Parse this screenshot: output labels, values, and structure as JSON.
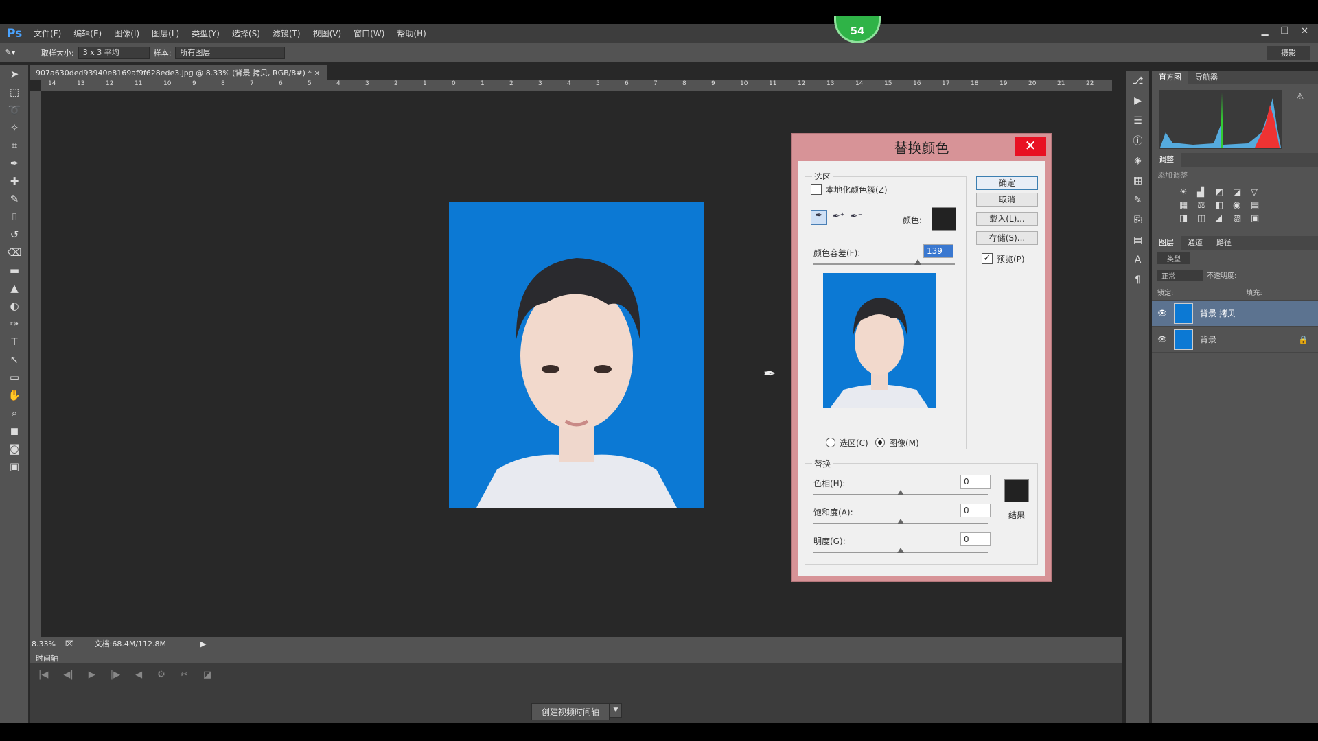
{
  "menubar": {
    "logo": "Ps",
    "items": [
      "文件(F)",
      "编辑(E)",
      "图像(I)",
      "图层(L)",
      "类型(Y)",
      "选择(S)",
      "滤镜(T)",
      "视图(V)",
      "窗口(W)",
      "帮助(H)"
    ],
    "badge": "54"
  },
  "options": {
    "sample_size_label": "取样大小:",
    "sample_size": "3 x 3 平均",
    "sample_label": "样本:",
    "sample": "所有图层",
    "workspace": "摄影"
  },
  "doc": {
    "tab": "907a630ded93940e8169af9f628ede3.jpg @ 8.33% (背景 拷贝, RGB/8#) *",
    "ruler_ticks": [
      "14",
      "13",
      "12",
      "11",
      "10",
      "9",
      "8",
      "7",
      "6",
      "5",
      "4",
      "3",
      "2",
      "1",
      "0",
      "1",
      "2",
      "3",
      "4",
      "5",
      "6",
      "7",
      "8",
      "9",
      "10",
      "11",
      "12",
      "13",
      "14",
      "15",
      "16",
      "17",
      "18",
      "19",
      "20",
      "21",
      "22"
    ]
  },
  "status": {
    "zoom": "8.33%",
    "doc_info": "文档:68.4M/112.8M"
  },
  "timeline": {
    "title": "时间轴",
    "create_btn": "创建视频时间轴"
  },
  "panels": {
    "histogram_tab": "直方图",
    "navigator_tab": "导航器",
    "adjust_tab": "调整",
    "adjust_hint": "添加调整",
    "layers_tab": "图层",
    "channels_tab": "通道",
    "paths_tab": "路径",
    "kind": "类型",
    "blend": "正常",
    "opacity_label": "不透明度:",
    "lock_label": "锁定:",
    "fill_label": "填充:"
  },
  "layers": [
    {
      "name": "背景 拷贝",
      "selected": true
    },
    {
      "name": "背景",
      "selected": false
    }
  ],
  "dialog": {
    "title": "替换颜色",
    "close": "✕",
    "selection_group": "选区",
    "localized": "本地化颜色簇(Z)",
    "color_label": "颜色:",
    "fuzziness_label": "颜色容差(F):",
    "fuzziness": "139",
    "fuzziness_pct": 0.74,
    "radio_selection": "选区(C)",
    "radio_image": "图像(M)",
    "radio_value": "image",
    "ok": "确定",
    "cancel": "取消",
    "load": "载入(L)...",
    "save": "存储(S)...",
    "preview": "预览(P)",
    "preview_checked": true,
    "replace_group": "替换",
    "hue_label": "色相(H):",
    "hue": "0",
    "sat_label": "饱和度(A):",
    "sat": "0",
    "light_label": "明度(G):",
    "light": "0",
    "result_label": "结果",
    "hue_pct": 0.5,
    "sat_pct": 0.5,
    "light_pct": 0.5
  },
  "colors": {
    "photo_bg": "#0c79d4",
    "dialog_frame": "#d79397",
    "accent": "#4aa3ff",
    "badge": "#2fb347",
    "selected_layer": "#5c7390"
  }
}
